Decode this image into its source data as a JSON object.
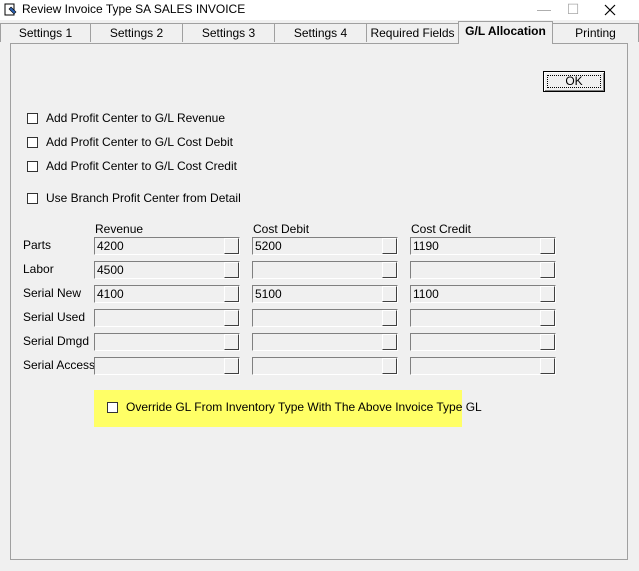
{
  "window": {
    "title": "Review Invoice Type  SA SALES INVOICE",
    "minimize": "—",
    "maximize": "☐"
  },
  "tabs": [
    {
      "label": "Settings 1"
    },
    {
      "label": "Settings 2"
    },
    {
      "label": "Settings 3"
    },
    {
      "label": "Settings 4"
    },
    {
      "label": "Required Fields"
    },
    {
      "label": "G/L Allocation"
    },
    {
      "label": "Printing"
    }
  ],
  "active_tab": "G/L Allocation",
  "ok_label": "OK",
  "checkboxes": {
    "revenue": {
      "label": "Add Profit Center to G/L Revenue",
      "checked": false
    },
    "cost_debit": {
      "label": "Add Profit Center to G/L Cost Debit",
      "checked": false
    },
    "cost_credit": {
      "label": "Add Profit Center to G/L Cost Credit",
      "checked": false
    },
    "branch": {
      "label": "Use Branch Profit Center from Detail",
      "checked": false
    },
    "override": {
      "label": "Override GL From Inventory Type With The Above Invoice Type GL",
      "checked": false
    }
  },
  "columns": {
    "revenue": "Revenue",
    "cost_debit": "Cost Debit",
    "cost_credit": "Cost Credit"
  },
  "rows": [
    {
      "label": "Parts",
      "revenue": "4200",
      "cost_debit": "5200",
      "cost_credit": "1190"
    },
    {
      "label": "Labor",
      "revenue": "4500",
      "cost_debit": "",
      "cost_credit": ""
    },
    {
      "label": "Serial New",
      "revenue": "4100",
      "cost_debit": "5100",
      "cost_credit": "1100"
    },
    {
      "label": "Serial Used",
      "revenue": "",
      "cost_debit": "",
      "cost_credit": ""
    },
    {
      "label": "Serial Dmgd",
      "revenue": "",
      "cost_debit": "",
      "cost_credit": ""
    },
    {
      "label": "Serial Access",
      "revenue": "",
      "cost_debit": "",
      "cost_credit": ""
    }
  ],
  "colors": {
    "highlight": "#ffff66",
    "background": "#f0f0f0"
  }
}
